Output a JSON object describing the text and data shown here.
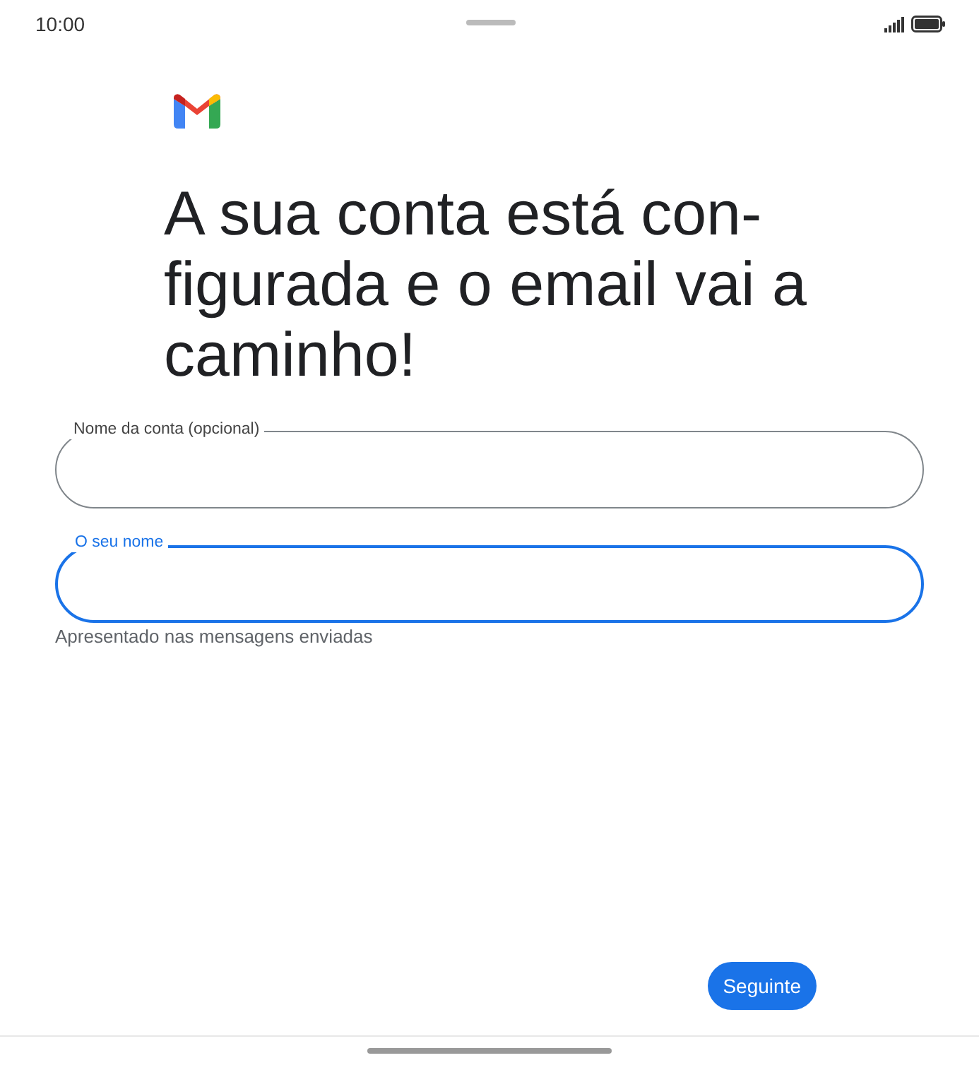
{
  "status_bar": {
    "time": "10:00"
  },
  "title": "A sua conta está con-figurada e o email vai a caminho!",
  "fields": [
    {
      "label": "Nome da conta (opcional)",
      "focused": false
    },
    {
      "label": "O seu nome",
      "focused": true,
      "helper": "Apresentado nas mensagens enviadas"
    }
  ],
  "next_button": "Seguinte"
}
